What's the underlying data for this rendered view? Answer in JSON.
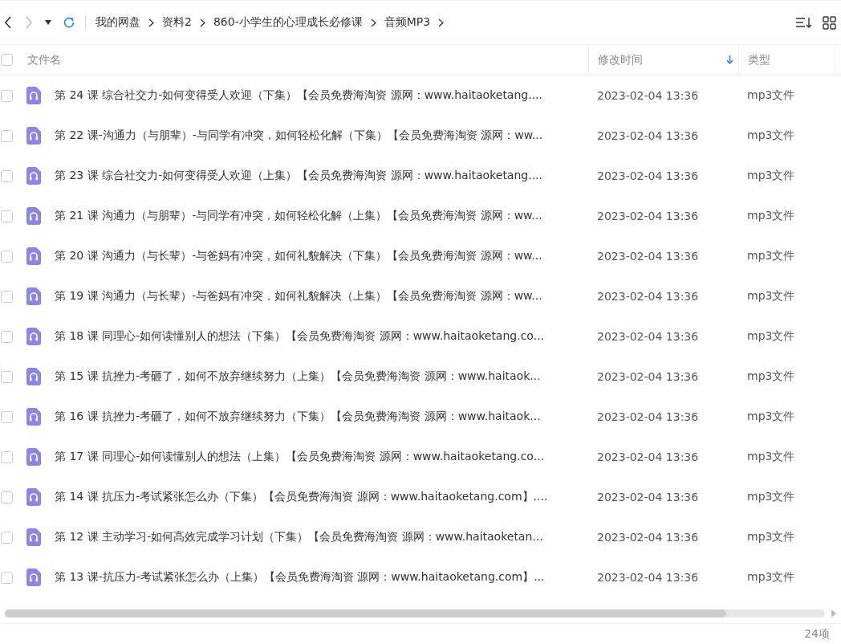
{
  "breadcrumb": [
    "我的网盘",
    "资料2",
    "860-小学生的心理成长必修课",
    "音频MP3"
  ],
  "columns": {
    "name": "文件名",
    "modified": "修改时间",
    "type": "类型",
    "select_all_checked": false
  },
  "files": [
    {
      "name": "第 24 课 综合社交力-如何变得受人欢迎（下集）【会员免费海淘资 源网：www.haitaoketang....",
      "modified": "2023-02-04 13:36",
      "type": "mp3文件",
      "checked": false
    },
    {
      "name": "第 22 课-沟通力（与朋辈）-与同学有冲突，如何轻松化解（下集）【会员免费海淘资 源网：ww...",
      "modified": "2023-02-04 13:36",
      "type": "mp3文件",
      "checked": false
    },
    {
      "name": "第 23 课 综合社交力-如何变得受人欢迎（上集）【会员免费海淘资 源网：www.haitaoketang....",
      "modified": "2023-02-04 13:36",
      "type": "mp3文件",
      "checked": false
    },
    {
      "name": "第 21 课 沟通力（与朋辈）-与同学有冲突，如何轻松化解（上集）【会员免费海淘资 源网：ww...",
      "modified": "2023-02-04 13:36",
      "type": "mp3文件",
      "checked": false
    },
    {
      "name": "第 20 课 沟通力（与长辈）-与爸妈有冲突，如何礼貌解决（下集）【会员免费海淘资 源网：ww...",
      "modified": "2023-02-04 13:36",
      "type": "mp3文件",
      "checked": false
    },
    {
      "name": "第 19 课 沟通力（与长辈）-与爸妈有冲突，如何礼貌解决（上集）【会员免费海淘资 源网：ww...",
      "modified": "2023-02-04 13:36",
      "type": "mp3文件",
      "checked": false
    },
    {
      "name": "第 18 课 同理心-如何读懂别人的想法（下集）【会员免费海淘资 源网：www.haitaoketang.co...",
      "modified": "2023-02-04 13:36",
      "type": "mp3文件",
      "checked": false
    },
    {
      "name": "第 15 课 抗挫力-考砸了，如何不放弃继续努力（上集）【会员免费海淘资 源网：www.haitaok...",
      "modified": "2023-02-04 13:36",
      "type": "mp3文件",
      "checked": false
    },
    {
      "name": "第 16 课 抗挫力-考砸了，如何不放弃继续努力（下集）【会员免费海淘资 源网：www.haitaok...",
      "modified": "2023-02-04 13:36",
      "type": "mp3文件",
      "checked": false
    },
    {
      "name": "第 17 课 同理心-如何读懂别人的想法（上集）【会员免费海淘资 源网：www.haitaoketang.co...",
      "modified": "2023-02-04 13:36",
      "type": "mp3文件",
      "checked": false
    },
    {
      "name": "第 14 课 抗压力-考试紧张怎么办（下集）【会员免费海淘资 源网：www.haitaoketang.com】....",
      "modified": "2023-02-04 13:36",
      "type": "mp3文件",
      "checked": false
    },
    {
      "name": "第 12 课 主动学习-如何高效完成学习计划（下集）【会员免费海淘资 源网：www.haitaoketan...",
      "modified": "2023-02-04 13:36",
      "type": "mp3文件",
      "checked": false
    },
    {
      "name": "第 13 课-抗压力-考试紧张怎么办（上集）【会员免费海淘资 源网：www.haitaoketang.com】...",
      "modified": "2023-02-04 13:36",
      "type": "mp3文件",
      "checked": false
    }
  ],
  "status_bar": {
    "count": "24项"
  }
}
